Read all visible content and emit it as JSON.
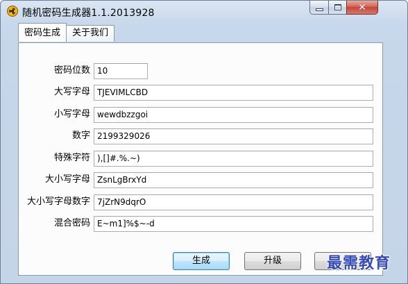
{
  "window": {
    "title": "随机密码生成器1.1.2013928",
    "close_glyph": "✕"
  },
  "tabs": [
    {
      "label": "密码生成",
      "active": true
    },
    {
      "label": "关于我们",
      "active": false
    }
  ],
  "form": {
    "fields": [
      {
        "label": "密码位数",
        "value": "10"
      },
      {
        "label": "大写字母",
        "value": "TJEVIMLCBD"
      },
      {
        "label": "小写字母",
        "value": "wewdbzzgoi"
      },
      {
        "label": "数字",
        "value": "2199329026"
      },
      {
        "label": "特殊字符",
        "value": "),[]#.%.~)"
      },
      {
        "label": "大小写字母",
        "value": "ZsnLgBrxYd"
      },
      {
        "label": "大小写字母数字",
        "value": "7jZrN9dqrO"
      },
      {
        "label": "混合密码",
        "value": "E~m1]%$~-d"
      }
    ]
  },
  "buttons": {
    "generate": "生成",
    "upgrade": "升级",
    "third": ""
  },
  "watermark": "最需教育",
  "colors": {
    "title_bar": "#c9d9ec",
    "close_button": "#c4463a",
    "default_button_border": "#3c7fb1",
    "watermark": "#2a3fb0"
  }
}
